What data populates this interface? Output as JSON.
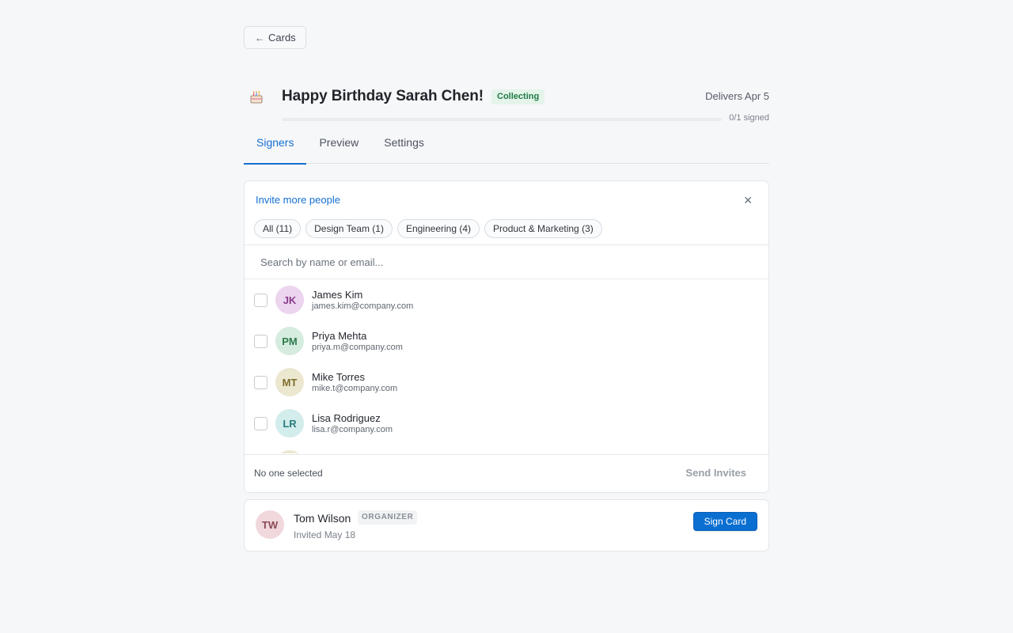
{
  "nav": {
    "back_label": "Cards",
    "back_icon": "arrow-left-icon"
  },
  "card": {
    "icon": "birthday-cake-icon",
    "title": "Happy Birthday Sarah Chen!",
    "status": "Collecting",
    "delivers": "Delivers Apr 5",
    "signed_count": "0/1 signed",
    "progress_fraction": 0
  },
  "tabs": [
    {
      "label": "Signers",
      "active": true
    },
    {
      "label": "Preview",
      "active": false
    },
    {
      "label": "Settings",
      "active": false
    }
  ],
  "invite": {
    "title": "Invite more people",
    "close_icon": "close-icon",
    "filters": [
      {
        "label": "All (11)"
      },
      {
        "label": "Design Team (1)"
      },
      {
        "label": "Engineering (4)"
      },
      {
        "label": "Product & Marketing (3)"
      }
    ],
    "search_placeholder": "Search by name or email...",
    "people": [
      {
        "initials": "JK",
        "name": "James Kim",
        "email": "james.kim@company.com",
        "avatar_bg": "#ecd5ee",
        "avatar_fg": "#8a3a8d"
      },
      {
        "initials": "PM",
        "name": "Priya Mehta",
        "email": "priya.m@company.com",
        "avatar_bg": "#d6ecdf",
        "avatar_fg": "#2f7a4c"
      },
      {
        "initials": "MT",
        "name": "Mike Torres",
        "email": "mike.t@company.com",
        "avatar_bg": "#ece7cf",
        "avatar_fg": "#7d6d2b"
      },
      {
        "initials": "LR",
        "name": "Lisa Rodriguez",
        "email": "lisa.r@company.com",
        "avatar_bg": "#d3ecec",
        "avatar_fg": "#2a7b7b"
      }
    ],
    "selection_text": "No one selected",
    "send_label": "Send Invites"
  },
  "signers": [
    {
      "initials": "TW",
      "name": "Tom Wilson",
      "role": "ORGANIZER",
      "invited": "Invited May 18",
      "action_label": "Sign Card",
      "avatar_bg": "#f1d8dc",
      "avatar_fg": "#8c4a55"
    }
  ],
  "colors": {
    "accent": "#0a6fd1",
    "status_bg": "#e4f4ea",
    "status_fg": "#1f7a45"
  }
}
